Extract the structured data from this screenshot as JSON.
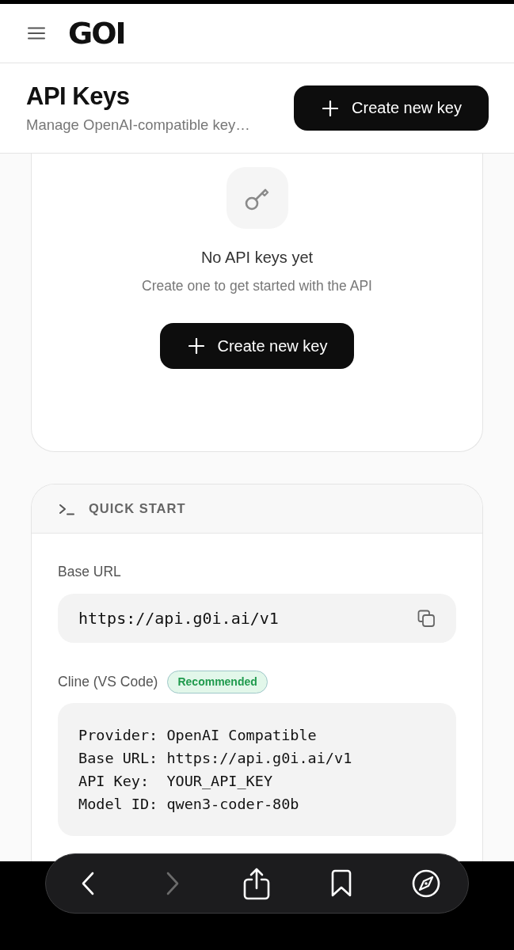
{
  "header": {
    "logo": "GOI"
  },
  "page": {
    "title": "API Keys",
    "subtitle": "Manage OpenAI-compatible key…",
    "primary_button": {
      "label": "Create new key"
    }
  },
  "empty_state": {
    "title": "No API keys yet",
    "message": "Create one to get started with the API",
    "button": {
      "label": "Create new key"
    }
  },
  "quick_start": {
    "title": "QUICK START",
    "sections": [
      {
        "kind": "field",
        "label": "Base URL",
        "value": "https://api.g0i.ai/v1"
      },
      {
        "kind": "code",
        "label": "Cline (VS Code)",
        "badge": "Recommended",
        "lines": [
          "Provider: OpenAI Compatible",
          "Base URL: https://api.g0i.ai/v1",
          "API Key:  YOUR_API_KEY",
          "Model ID: qwen3-coder-80b"
        ]
      }
    ]
  },
  "browser_toolbar": {
    "buttons": [
      {
        "kind": "back",
        "disabled": false
      },
      {
        "kind": "forward",
        "disabled": true
      },
      {
        "kind": "share",
        "disabled": false
      },
      {
        "kind": "bookmarks",
        "disabled": false
      },
      {
        "kind": "compass",
        "disabled": false
      }
    ]
  }
}
